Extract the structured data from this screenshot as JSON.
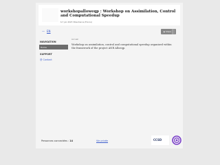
{
  "header": {
    "title": "workshopalloweqp : Workshop on Assimilation, Control and Computational Speedup",
    "subtitle": "6-7 juin 2023 Villeurbanne (France)"
  },
  "lang": {
    "fr": "—",
    "en": "EN"
  },
  "share": {
    "label": "▶ Share"
  },
  "sidebar": {
    "navigation_title": "NAVIGATION",
    "items": [
      {
        "label": "Home"
      }
    ],
    "support_title": "SUPPORT",
    "contact_label": "@ Contact"
  },
  "main": {
    "breadcrumb": "Accueil",
    "description": "Workshop on assimilation, control and computational speedup organized within the framework of the project ANR Alloeqp."
  },
  "footer": {
    "connections_label": "Personnes connectées :",
    "connections_count": "14",
    "legal_label": "Vie privée",
    "ccsd_label": "CCSD"
  },
  "colors": {
    "accent": "#3a5ccc",
    "nav_active": "#6c6c6c",
    "logo_purple": "#7a3fc9"
  }
}
